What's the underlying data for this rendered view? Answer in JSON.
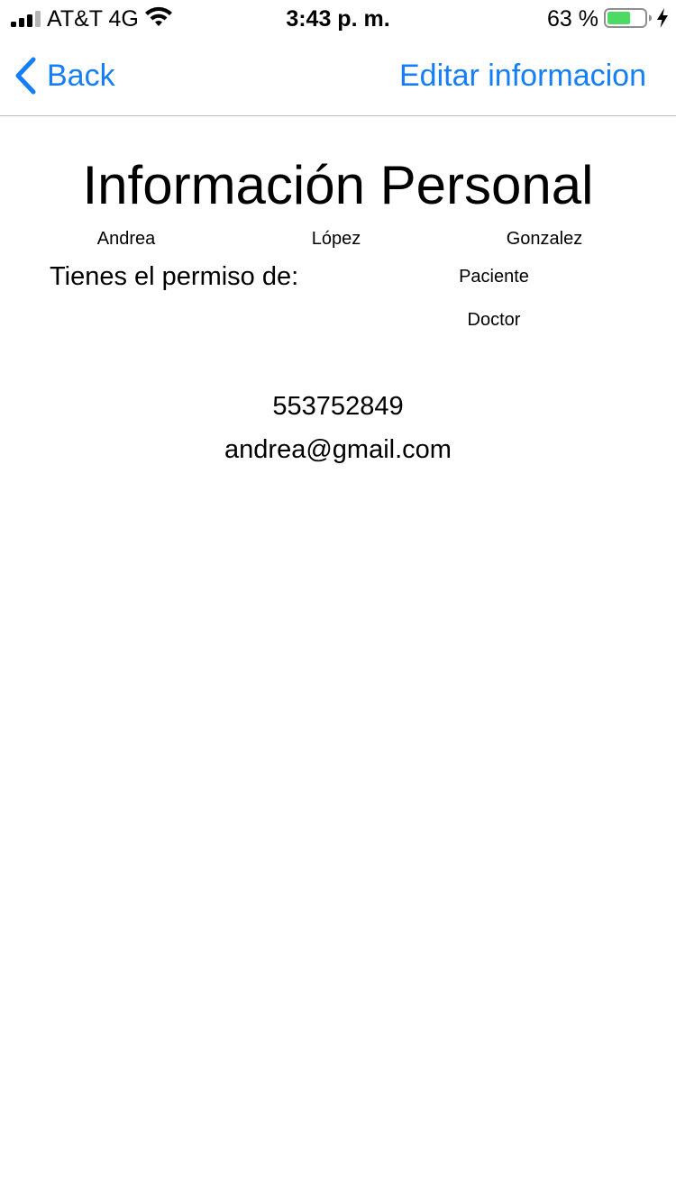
{
  "status_bar": {
    "carrier": "AT&T 4G",
    "time": "3:43 p. m.",
    "battery_percent": "63 %",
    "signal_icon": "cellular-signal-icon",
    "wifi_icon": "wifi-icon",
    "battery_icon": "battery-icon",
    "charging_icon": "charging-bolt-icon",
    "battery_level": 0.63,
    "battery_color": "#4cd964"
  },
  "nav": {
    "back_label": "Back",
    "back_icon": "chevron-left-icon",
    "edit_label": "Editar informacion",
    "accent_color": "#147efb"
  },
  "profile": {
    "title": "Información Personal",
    "first_name": "Andrea",
    "last_name_1": "López",
    "last_name_2": "Gonzalez",
    "permission_label": "Tienes el permiso de:",
    "roles": [
      "Paciente",
      "Doctor"
    ],
    "phone": "553752849",
    "email": "andrea@gmail.com"
  }
}
